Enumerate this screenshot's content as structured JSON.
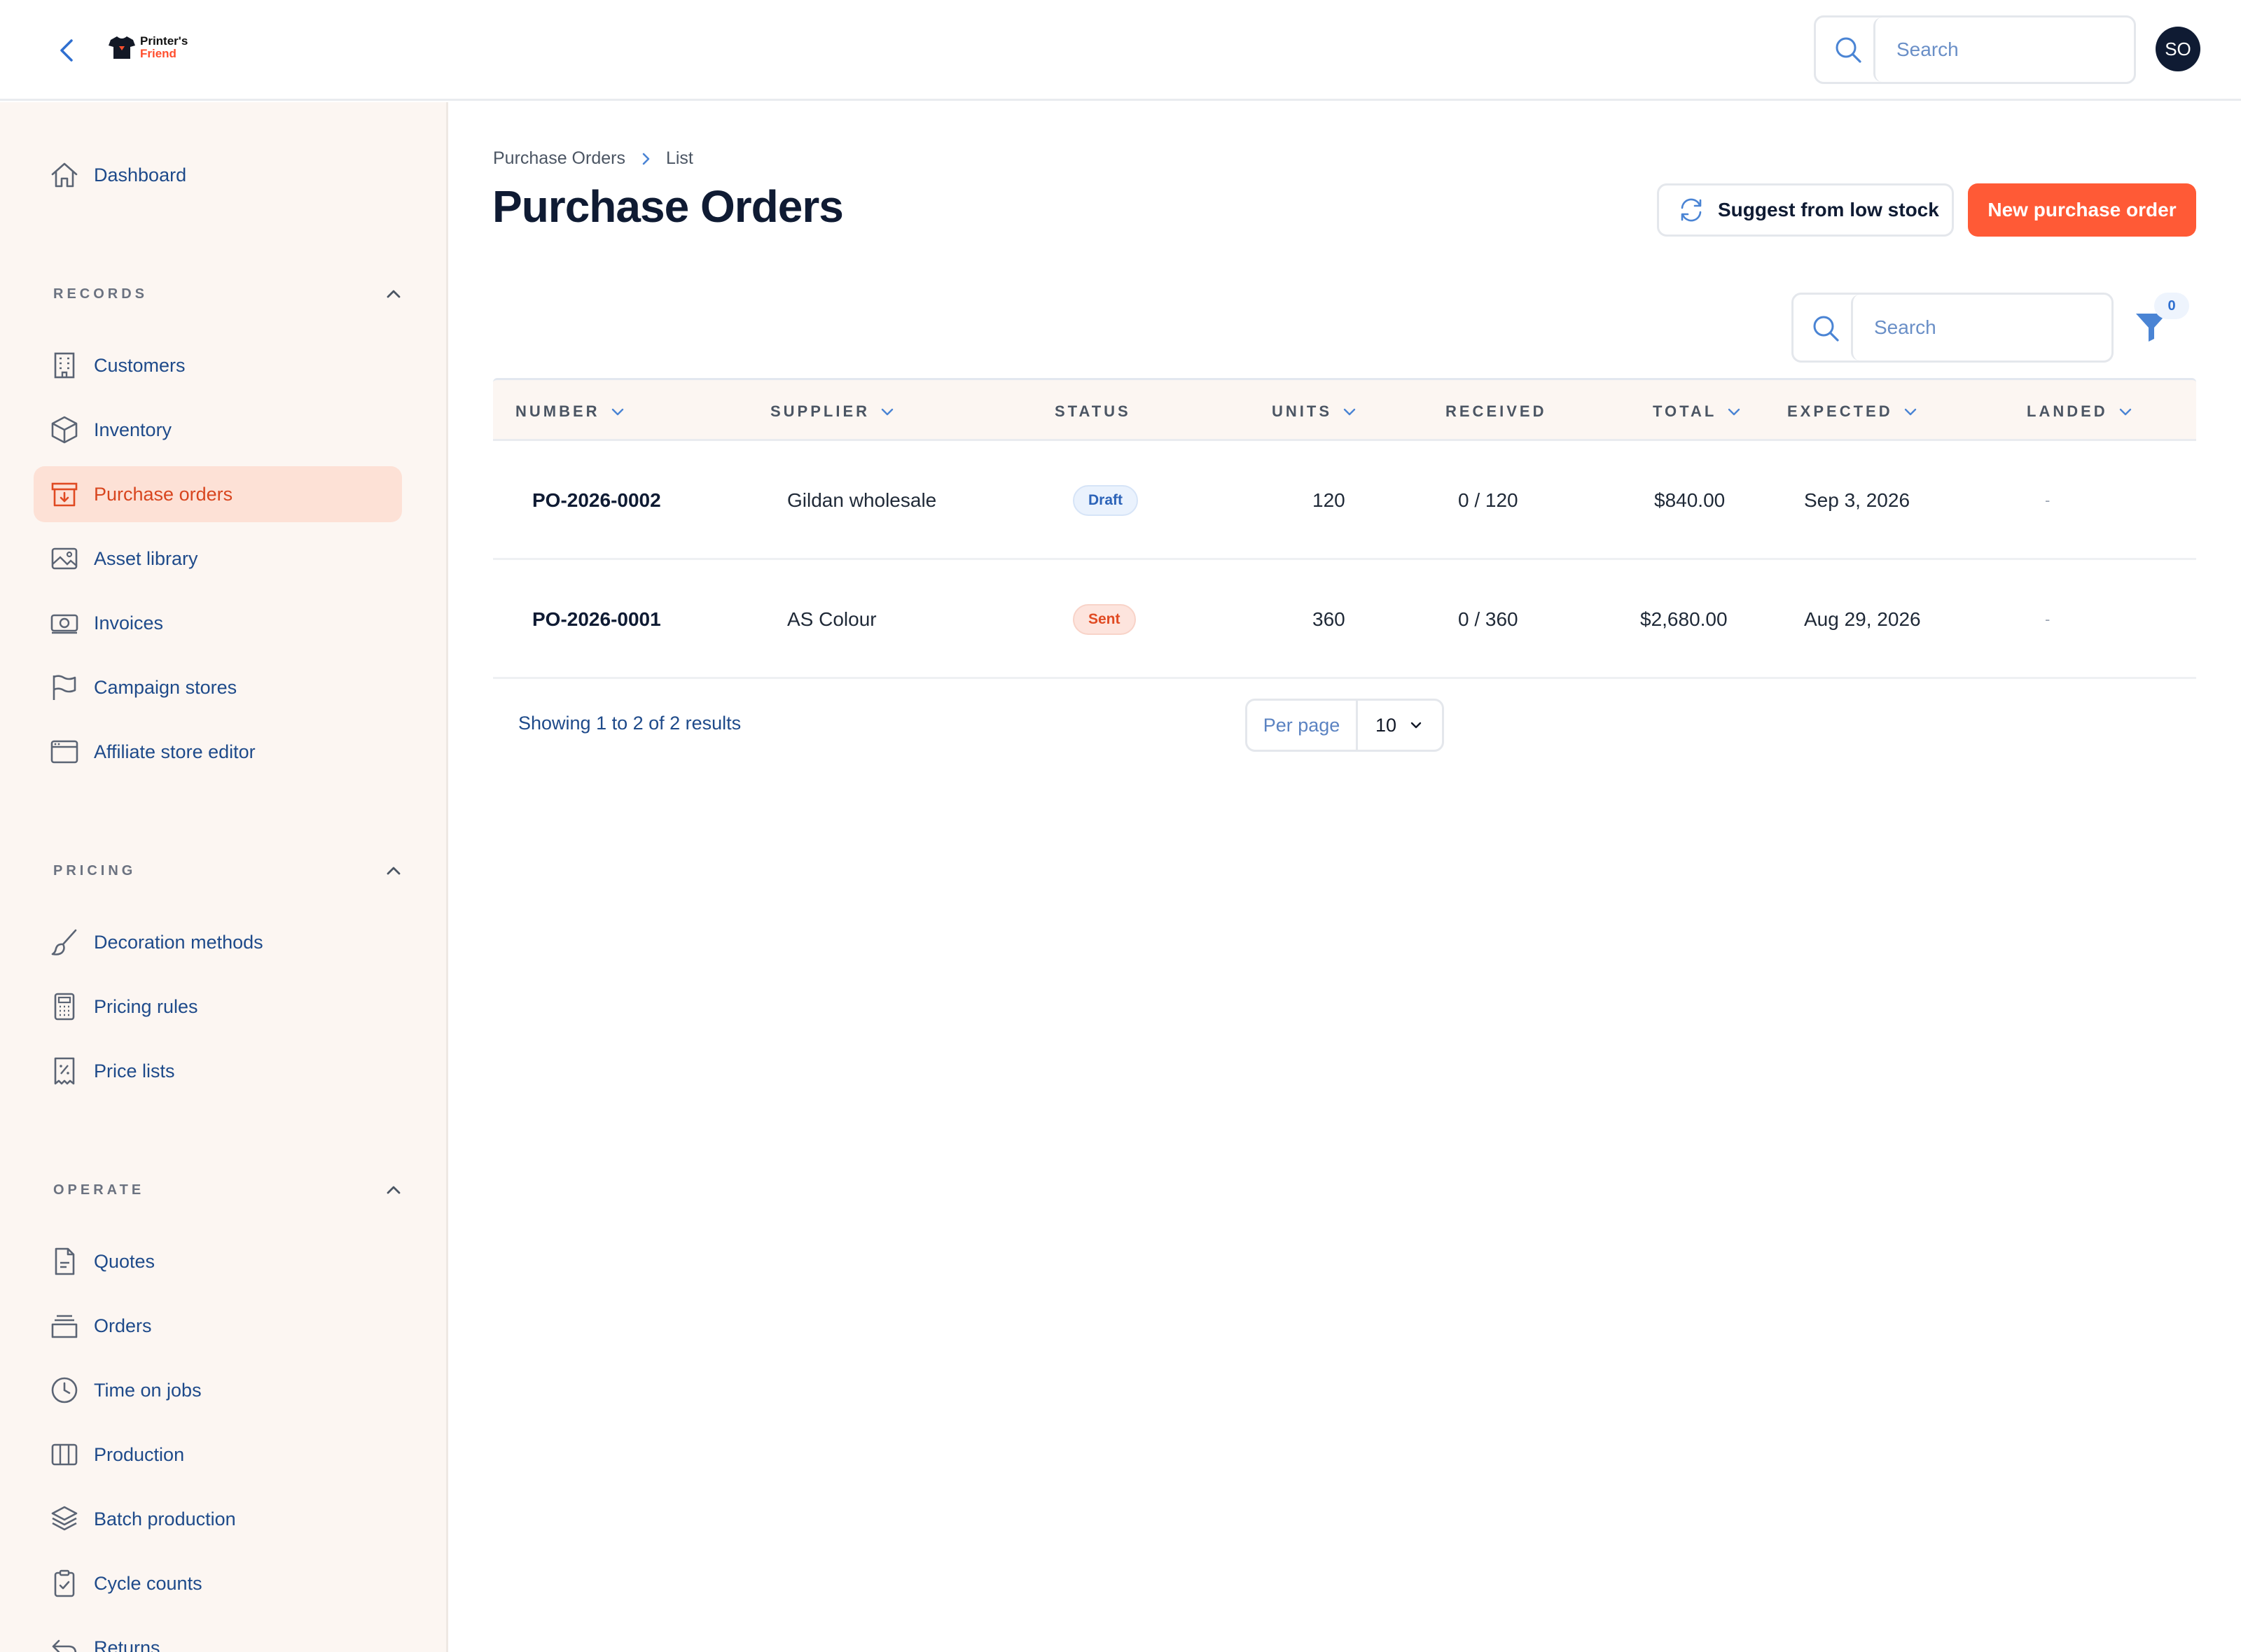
{
  "brand": {
    "line1": "Printer's",
    "line2": "Friend"
  },
  "header": {
    "search_placeholder": "Search",
    "avatar_initials": "SO"
  },
  "sidebar": {
    "dashboard": "Dashboard",
    "sections": {
      "records": "RECORDS",
      "pricing": "PRICING",
      "operate": "OPERATE"
    },
    "records_items": [
      {
        "label": "Customers",
        "icon": "building-icon"
      },
      {
        "label": "Inventory",
        "icon": "box-icon"
      },
      {
        "label": "Purchase orders",
        "icon": "archive-down-icon",
        "active": true
      },
      {
        "label": "Asset library",
        "icon": "image-icon"
      },
      {
        "label": "Invoices",
        "icon": "cash-icon"
      },
      {
        "label": "Campaign stores",
        "icon": "flag-icon"
      },
      {
        "label": "Affiliate store editor",
        "icon": "browser-window-icon"
      }
    ],
    "pricing_items": [
      {
        "label": "Decoration methods",
        "icon": "paintbrush-icon"
      },
      {
        "label": "Pricing rules",
        "icon": "calculator-icon"
      },
      {
        "label": "Price lists",
        "icon": "receipt-percent-icon"
      }
    ],
    "operate_items": [
      {
        "label": "Quotes",
        "icon": "document-icon"
      },
      {
        "label": "Orders",
        "icon": "tray-stack-icon"
      },
      {
        "label": "Time on jobs",
        "icon": "clock-icon"
      },
      {
        "label": "Production",
        "icon": "columns-icon"
      },
      {
        "label": "Batch production",
        "icon": "layers-icon"
      },
      {
        "label": "Cycle counts",
        "icon": "clipboard-check-icon"
      },
      {
        "label": "Returns",
        "icon": "return-arrow-icon"
      }
    ]
  },
  "breadcrumb": {
    "parent": "Purchase Orders",
    "current": "List"
  },
  "page": {
    "title": "Purchase Orders",
    "suggest_button": "Suggest from low stock",
    "new_button": "New purchase order"
  },
  "table": {
    "search_placeholder": "Search",
    "filter_count": "0",
    "columns": {
      "number": "NUMBER",
      "supplier": "SUPPLIER",
      "status": "STATUS",
      "units": "UNITS",
      "received": "RECEIVED",
      "total": "TOTAL",
      "expected": "EXPECTED",
      "landed": "LANDED"
    },
    "rows": [
      {
        "number": "PO-2026-0002",
        "supplier": "Gildan wholesale",
        "status": "Draft",
        "units": "120",
        "received": "0 / 120",
        "total": "$840.00",
        "expected": "Sep 3, 2026",
        "landed": "-"
      },
      {
        "number": "PO-2026-0001",
        "supplier": "AS Colour",
        "status": "Sent",
        "units": "360",
        "received": "0 / 360",
        "total": "$2,680.00",
        "expected": "Aug 29, 2026",
        "landed": "-"
      }
    ]
  },
  "pagination": {
    "summary": "Showing 1 to 2 of 2 results",
    "per_page_label": "Per page",
    "per_page_value": "10"
  },
  "colors": {
    "accent": "#ff5a36",
    "navy": "#0f1b33",
    "link": "#1e4a8a",
    "sidebar_bg": "#fcf6f2",
    "active_bg": "#fde1d6"
  }
}
